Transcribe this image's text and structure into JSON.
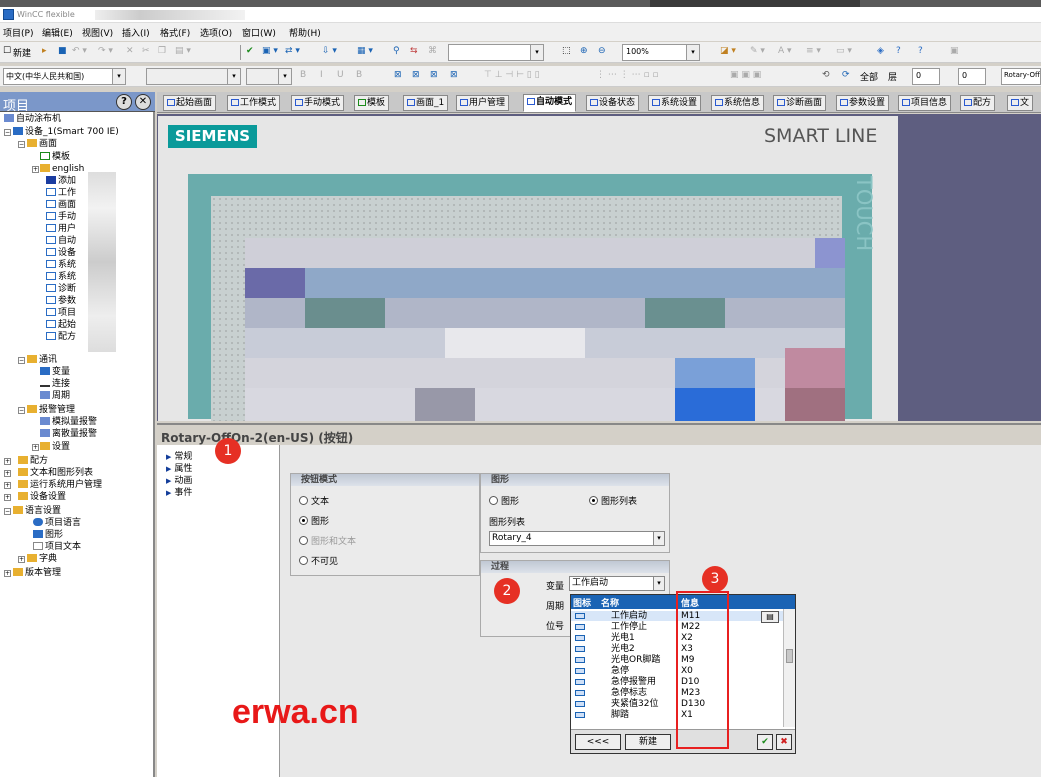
{
  "window": {
    "title": "WinCC flexible"
  },
  "menu": [
    "项目(P)",
    "编辑(E)",
    "视图(V)",
    "插入(I)",
    "格式(F)",
    "选项(O)",
    "窗口(W)",
    "帮助(H)"
  ],
  "toolbar1": {
    "new_label": "新建",
    "zoom": "100%"
  },
  "toolbar2": {
    "language": "中文(中华人民共和国)",
    "all_label": "全部",
    "layer_label": "层",
    "layer_value": "0",
    "level_value": "0",
    "object": "Rotary-Off"
  },
  "project": {
    "title": "项目",
    "items": {
      "root": "自动涂布机",
      "device": "设备_1(Smart 700 IE)",
      "screens": "画面",
      "template": "模板",
      "english": "english",
      "add": "添加",
      "s1": "工作",
      "s2": "画面",
      "s3": "手动",
      "s4": "用户",
      "s5": "自动",
      "s6": "设备",
      "s7": "系统",
      "s8": "系统",
      "s9": "诊断",
      "s10": "参数",
      "s11": "项目",
      "s12": "起始",
      "s13": "配方",
      "comm": "通讯",
      "vars": "变量",
      "conn": "连接",
      "cycle": "周期",
      "alarm": "报警管理",
      "analog": "模拟量报警",
      "discrete": "离散量报警",
      "settings": "设置",
      "recipe": "配方",
      "textlist": "文本和图形列表",
      "runtime": "运行系统用户管理",
      "devset": "设备设置",
      "langset": "语言设置",
      "projlang": "项目语言",
      "graphics": "图形",
      "projtext": "项目文本",
      "dict": "字典",
      "version": "版本管理"
    }
  },
  "tabs": [
    "起始画面",
    "工作模式",
    "手动模式",
    "模板",
    "画面_1",
    "用户管理",
    "自动模式",
    "设备状态",
    "系统设置",
    "系统信息",
    "诊断画面",
    "参数设置",
    "项目信息",
    "配方",
    "文"
  ],
  "active_tab": "自动模式",
  "hmi": {
    "brand": "SIEMENS",
    "line": "SMART LINE",
    "touch": "TOUCH"
  },
  "props": {
    "title": "Rotary-OffOn-2(en-US) (按钮)",
    "nav": [
      "常规",
      "属性",
      "动画",
      "事件"
    ],
    "button_mode": {
      "title": "按钮模式",
      "options": [
        "文本",
        "图形",
        "图形和文本",
        "不可见"
      ],
      "selected": "图形"
    },
    "graphic": {
      "title": "图形",
      "options": [
        "图形",
        "图形列表"
      ],
      "selected": "图形列表",
      "list_label": "图形列表",
      "list_value": "Rotary_4"
    },
    "process": {
      "title": "过程",
      "var_label": "变量",
      "var_value": "工作启动",
      "period_label": "周期",
      "bit_label": "位号"
    }
  },
  "tag_dropdown": {
    "headers": [
      "图标",
      "名称",
      "信息"
    ],
    "rows": [
      {
        "name": "工作启动",
        "info": "M11"
      },
      {
        "name": "工作停止",
        "info": "M22"
      },
      {
        "name": "光电1",
        "info": "X2"
      },
      {
        "name": "光电2",
        "info": "X3"
      },
      {
        "name": "光电OR脚踏",
        "info": "M9"
      },
      {
        "name": "急停",
        "info": "X0"
      },
      {
        "name": "急停报警用",
        "info": "D10"
      },
      {
        "name": "急停标志",
        "info": "M23"
      },
      {
        "name": "夹紧值32位",
        "info": "D130"
      },
      {
        "name": "脚踏",
        "info": "X1"
      }
    ],
    "back_label": "<<<",
    "new_label": "新建"
  },
  "annotations": [
    "1",
    "2",
    "3"
  ],
  "watermark": "erwa.cn",
  "colors": {
    "accent": "#1a63b4",
    "badge": "#e63024",
    "siemens": "#0a9a9a"
  }
}
